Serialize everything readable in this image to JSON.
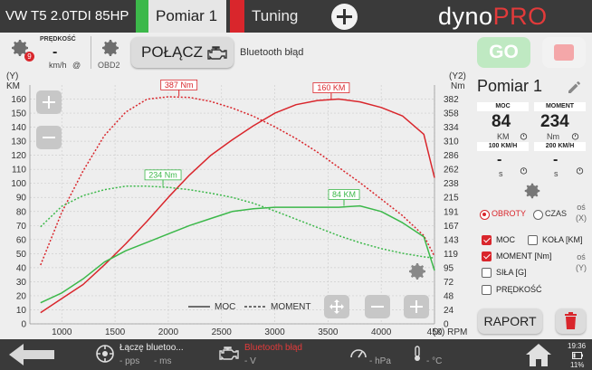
{
  "topbar": {
    "car_name": "VW T5 2.0TDI 85HP",
    "tabs": [
      {
        "label": "Pomiar 1",
        "accent": "#3cb84a",
        "active": true
      },
      {
        "label": "Tuning",
        "accent": "#d9262c",
        "active": false
      }
    ],
    "add_tab_icon": "plus-icon",
    "logo": {
      "part1": "dyno",
      "part2": "PRO"
    }
  },
  "header": {
    "settings_badge": "9",
    "speed_label": "PRĘDKOŚĆ",
    "speed_value": "-",
    "speed_unit": "km/h",
    "speed_unit_icon": "@",
    "obd_label": "OBD2",
    "connect_label": "POŁĄCZ",
    "bt_status": "Bluetooth błąd",
    "go_label": "GO"
  },
  "chart_data": {
    "type": "line",
    "x": [
      800,
      1000,
      1200,
      1400,
      1600,
      1800,
      2000,
      2200,
      2400,
      2600,
      2800,
      3000,
      3200,
      3400,
      3600,
      3800,
      4000,
      4200,
      4400,
      4500
    ],
    "series": [
      {
        "name": "MOC",
        "color": "#d9262c",
        "dash": false,
        "axis": "y1",
        "values": [
          8,
          18,
          28,
          42,
          57,
          73,
          90,
          106,
          120,
          131,
          141,
          150,
          156,
          159,
          160,
          158,
          154,
          148,
          135,
          104
        ]
      },
      {
        "name": "MOMENT",
        "color": "#d9262c",
        "dash": true,
        "axis": "y2",
        "values": [
          100,
          190,
          260,
          320,
          360,
          382,
          386,
          385,
          378,
          367,
          353,
          335,
          315,
          292,
          266,
          240,
          212,
          184,
          150,
          115
        ]
      },
      {
        "name": "MOC",
        "color": "#3cb84a",
        "dash": false,
        "axis": "y1",
        "values": [
          15,
          22,
          32,
          44,
          52,
          58,
          64,
          70,
          75,
          80,
          82,
          83,
          83,
          83,
          83,
          84,
          80,
          72,
          62,
          38
        ]
      },
      {
        "name": "MOMENT",
        "color": "#3cb84a",
        "dash": true,
        "axis": "y2",
        "values": [
          165,
          200,
          218,
          228,
          234,
          234,
          232,
          228,
          222,
          215,
          205,
          192,
          178,
          164,
          150,
          138,
          128,
          120,
          114,
          112
        ]
      }
    ],
    "xlim": [
      700,
      4500
    ],
    "x_ticks": [
      "1000",
      "1500",
      "2000",
      "2500",
      "3000",
      "3500",
      "4000",
      "450"
    ],
    "x_unit_label": "(X) RPM",
    "y1_label_top": "(Y)",
    "y1_label_unit": "KM",
    "y1_lim": [
      0,
      170
    ],
    "y1_ticks": [
      "0",
      "10",
      "20",
      "30",
      "40",
      "50",
      "60",
      "70",
      "80",
      "90",
      "100",
      "110",
      "120",
      "130",
      "140",
      "150",
      "160"
    ],
    "y2_label_top": "(Y2)",
    "y2_label_unit": "Nm",
    "y2_lim": [
      0,
      406
    ],
    "y2_ticks": [
      "0",
      "24",
      "48",
      "72",
      "95",
      "119",
      "143",
      "167",
      "191",
      "215",
      "238",
      "262",
      "286",
      "310",
      "334",
      "358",
      "382"
    ],
    "annotations": [
      {
        "label": "387 Nm",
        "x": 2100,
        "axis": "y2",
        "y": 387,
        "color": "#d9262c"
      },
      {
        "label": "160 KM",
        "x": 3530,
        "axis": "y1",
        "y": 160,
        "color": "#d9262c"
      },
      {
        "label": "234 Nm",
        "x": 1950,
        "axis": "y2",
        "y": 234,
        "color": "#3cb84a"
      },
      {
        "label": "84 KM",
        "x": 3650,
        "axis": "y1",
        "y": 84,
        "color": "#3cb84a"
      }
    ],
    "legend": [
      {
        "label": "MOC",
        "style": "solid"
      },
      {
        "label": "MOMENT",
        "style": "dashed"
      }
    ],
    "grid": true
  },
  "panel": {
    "run_title": "Pomiar 1",
    "moc_head": "MOC",
    "moment_head": "MOMENT",
    "moc_value": "84",
    "moment_value": "234",
    "moc_unit": "KM",
    "moment_unit": "Nm",
    "acc100_head": "100 KM/H",
    "acc200_head": "200 KM/H",
    "acc100_value": "-",
    "acc200_value": "-",
    "acc100_unit": "s",
    "acc200_unit": "s",
    "radio_obroty": "OBROTY",
    "radio_czas": "CZAS",
    "axis_x_label": "oś (X)",
    "cb_moc": "MOC",
    "cb_kola": "KOŁA [KM]",
    "cb_moment": "MOMENT [Nm]",
    "cb_sila": "SIŁA [G]",
    "cb_predkosc": "PRĘDKOŚĆ",
    "axis_y_label": "oś (Y)",
    "report_label": "RAPORT"
  },
  "bottombar": {
    "bt_connect": "Łączę bluetoo...",
    "pps": "- pps",
    "ms": "- ms",
    "bt_error": "Bluetooth błąd",
    "volt": "- V",
    "hpa": "- hPa",
    "temp": "- °C",
    "clock": "19:36",
    "battery": "11%"
  }
}
